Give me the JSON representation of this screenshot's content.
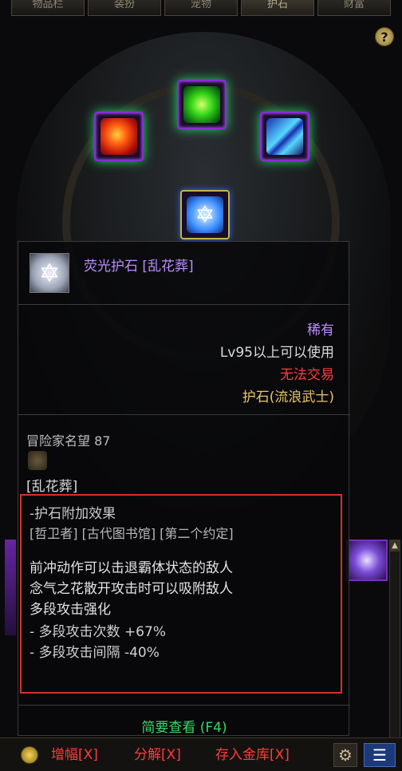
{
  "tabs": [
    "物品栏",
    "装扮",
    "宠物",
    "护石",
    "财富"
  ],
  "help_label": "?",
  "tooltip": {
    "title": "荧光护石 [乱花葬]",
    "rarity": "稀有",
    "level_req": "Lv95以上可以使用",
    "trade": "无法交易",
    "item_type": "护石(流浪武士)",
    "fame_label": "冒险家名望",
    "fame_value": "87",
    "set_name": "[乱花葬]",
    "effect_header": "-护石附加效果",
    "effect_sources": "[哲卫者] [古代图书馆] [第二个约定]",
    "effects": [
      "前冲动作可以击退霸体状态的敌人",
      "念气之花散开攻击时可以吸附敌人",
      "多段攻击强化",
      "-  多段攻击次数 +67%",
      "-  多段攻击间隔 -40%"
    ],
    "brief_view": "简要查看 (F4)"
  },
  "bottom_bar": {
    "boost": "增幅[X]",
    "disassemble": "分解[X]",
    "store": "存入金库[X]"
  },
  "colors": {
    "rare_purple": "#b98cff",
    "untradeable_red": "#ff3b3b",
    "type_gold": "#e8c36a",
    "brief_green": "#37d86a",
    "highlight_box": "#d6302a"
  },
  "icons": [
    "gem-red-icon",
    "gem-green-icon",
    "gem-blue-icon",
    "talisman-star-icon",
    "gold-coin-icon",
    "gear-icon",
    "menu-list-icon"
  ]
}
